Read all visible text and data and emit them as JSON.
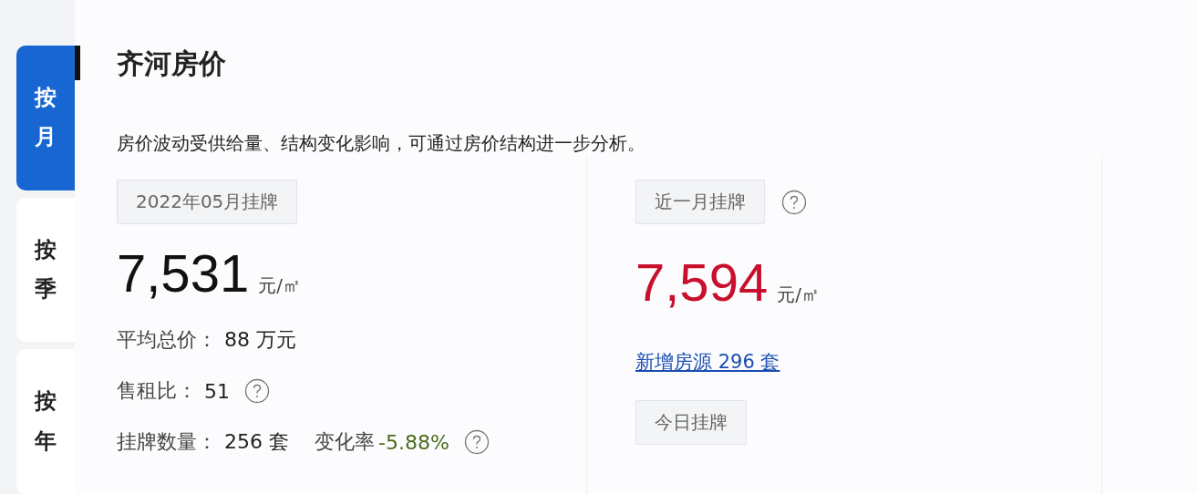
{
  "tabs": [
    {
      "label": "按月",
      "selected": true
    },
    {
      "label": "按季",
      "selected": false
    },
    {
      "label": "按年",
      "selected": false
    }
  ],
  "title": "齐河房价",
  "description": "房价波动受供给量、结构变化影响，可通过房价结构进一步分析。",
  "monthly": {
    "tag": "2022年05月挂牌",
    "price": "7,531",
    "unit": "元/㎡",
    "stats": [
      {
        "label": "平均总价：",
        "value": "88 万元"
      },
      {
        "label": "售租比：",
        "value": "51",
        "help": true
      },
      {
        "label": "挂牌数量：",
        "value": "256 套",
        "change_label": "变化率",
        "change": "-5.88%",
        "help": true
      }
    ]
  },
  "recent": {
    "tag": "近一月挂牌",
    "help": true,
    "price": "7,594",
    "unit": "元/㎡",
    "link": "新增房源 296 套",
    "today_tag": "今日挂牌"
  }
}
